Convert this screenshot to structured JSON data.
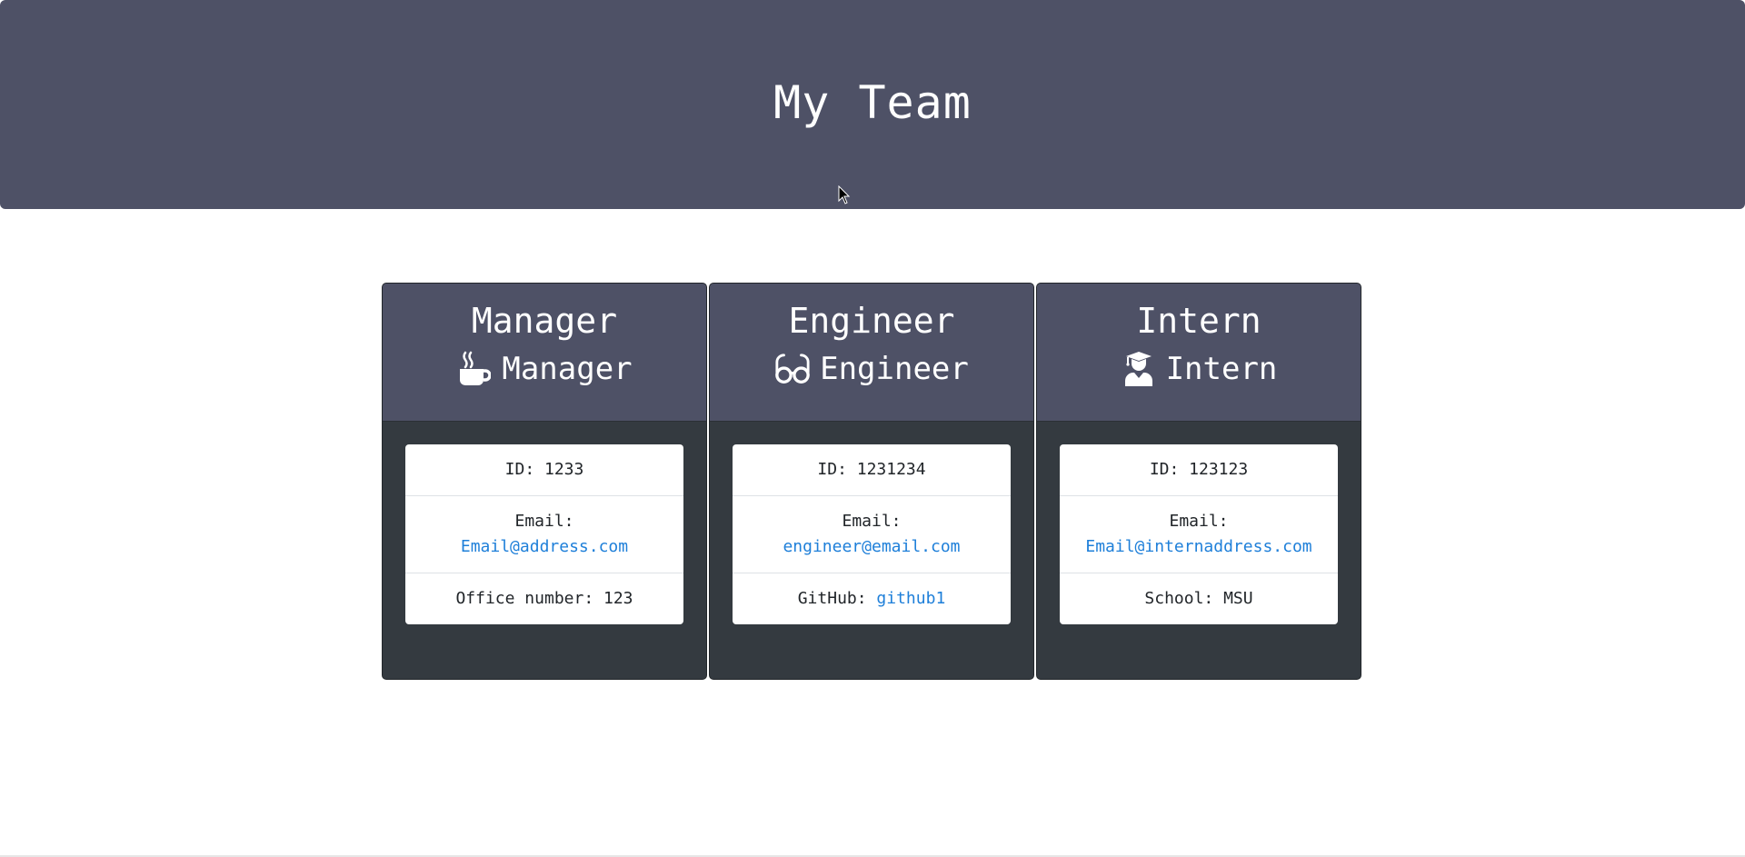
{
  "header": {
    "title": "My Team"
  },
  "colors": {
    "header_bg": "#4e5166",
    "card_body_bg": "#343a40",
    "link": "#1e7fd9"
  },
  "cards": [
    {
      "title": "Manager",
      "role": "Manager",
      "icon": "mug-hot-icon",
      "id_label": "ID: 1233",
      "email_label": "Email:",
      "email": "Email@address.com",
      "extra_label": "Office number: 123",
      "extra_link": ""
    },
    {
      "title": "Engineer",
      "role": "Engineer",
      "icon": "glasses-icon",
      "id_label": "ID: 1231234",
      "email_label": "Email:",
      "email": "engineer@email.com",
      "extra_label": "GitHub: ",
      "extra_link": "github1"
    },
    {
      "title": "Intern",
      "role": "Intern",
      "icon": "user-graduate-icon",
      "id_label": "ID: 123123",
      "email_label": "Email:",
      "email": "Email@internaddress.com",
      "extra_label": "School: MSU",
      "extra_link": ""
    }
  ]
}
